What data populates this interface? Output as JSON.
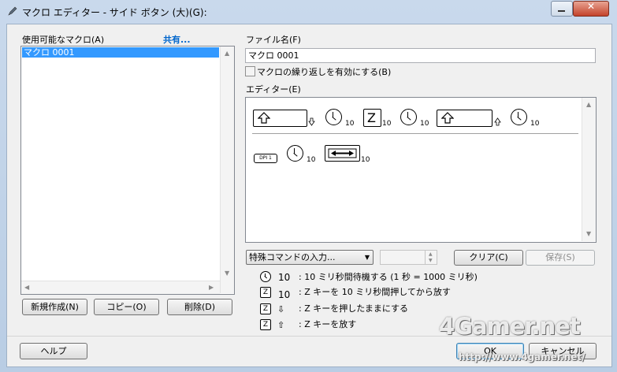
{
  "window": {
    "title": "マクロ エディター - サイド ボタン (大)(G):"
  },
  "macro_list": {
    "label": "使用可能なマクロ(A)",
    "share_link": "共有...",
    "items": [
      "マクロ 0001"
    ]
  },
  "buttons": {
    "new": "新規作成(N)",
    "copy": "コピー(O)",
    "delete": "削除(D)",
    "help": "ヘルプ",
    "clear": "クリア(C)",
    "save": "保存(S)",
    "ok": "OK",
    "cancel": "キャンセル"
  },
  "file": {
    "label": "ファイル名(F)",
    "value": "マクロ 0001"
  },
  "repeat": {
    "label": "マクロの繰り返しを有効にする(B)",
    "checked": false
  },
  "editor": {
    "label": "エディター(E)",
    "row1": [
      {
        "type": "key-down",
        "key": "shift-icon"
      },
      {
        "type": "delay",
        "value": "10"
      },
      {
        "type": "key",
        "key": "Z",
        "value": "10"
      },
      {
        "type": "delay",
        "value": "10"
      },
      {
        "type": "key-up",
        "key": "shift-icon"
      },
      {
        "type": "delay",
        "value": "10"
      }
    ],
    "row2": [
      {
        "type": "dpi",
        "label": "DPI 1"
      },
      {
        "type": "delay",
        "value": "10"
      },
      {
        "type": "key",
        "key": "resize-icon",
        "value": "10"
      }
    ]
  },
  "special_command": {
    "value": "特殊コマンドの入力..."
  },
  "legend": [
    {
      "icon": "clock-icon",
      "value": "10",
      "text": ": 10 ミリ秒間待機する (1 秒 = 1000 ミリ秒)"
    },
    {
      "icon": "Z",
      "value": "10",
      "text": ": Z キーを 10 ミリ秒間押してから放す"
    },
    {
      "icon": "Z",
      "value": "⇩",
      "text": ": Z キーを押したままにする"
    },
    {
      "icon": "Z",
      "value": "⇧",
      "text": ": Z キーを放す"
    }
  ],
  "watermark": {
    "brand": "4Gamer.net",
    "url": "http://www.4gamer.net/"
  }
}
